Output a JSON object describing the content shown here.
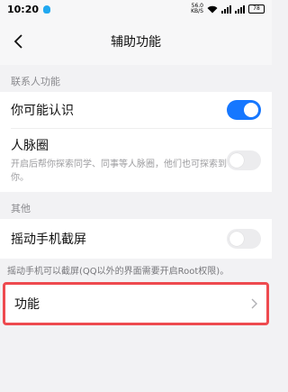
{
  "status_bar": {
    "time": "10:20",
    "net_speed": "56.0",
    "net_unit": "KB/S",
    "battery": "78"
  },
  "header": {
    "title": "辅助功能"
  },
  "sections": [
    {
      "label": "联系人功能",
      "items": [
        {
          "label": "你可能认识",
          "enabled": true
        },
        {
          "label": "人脉圈",
          "description": "开启后帮你探索同学、同事等人脉圈，他们也可探索到你。",
          "enabled": false
        }
      ]
    },
    {
      "label": "其他",
      "items": [
        {
          "label": "摇动手机截屏",
          "enabled": false
        }
      ],
      "note": "摇动手机可以截屏(QQ以外的界面需要开启Root权限)。"
    }
  ],
  "function_row": {
    "label": "功能"
  },
  "colors": {
    "toggle_on": "#1677ff",
    "highlight_border": "#ee4a4f"
  }
}
